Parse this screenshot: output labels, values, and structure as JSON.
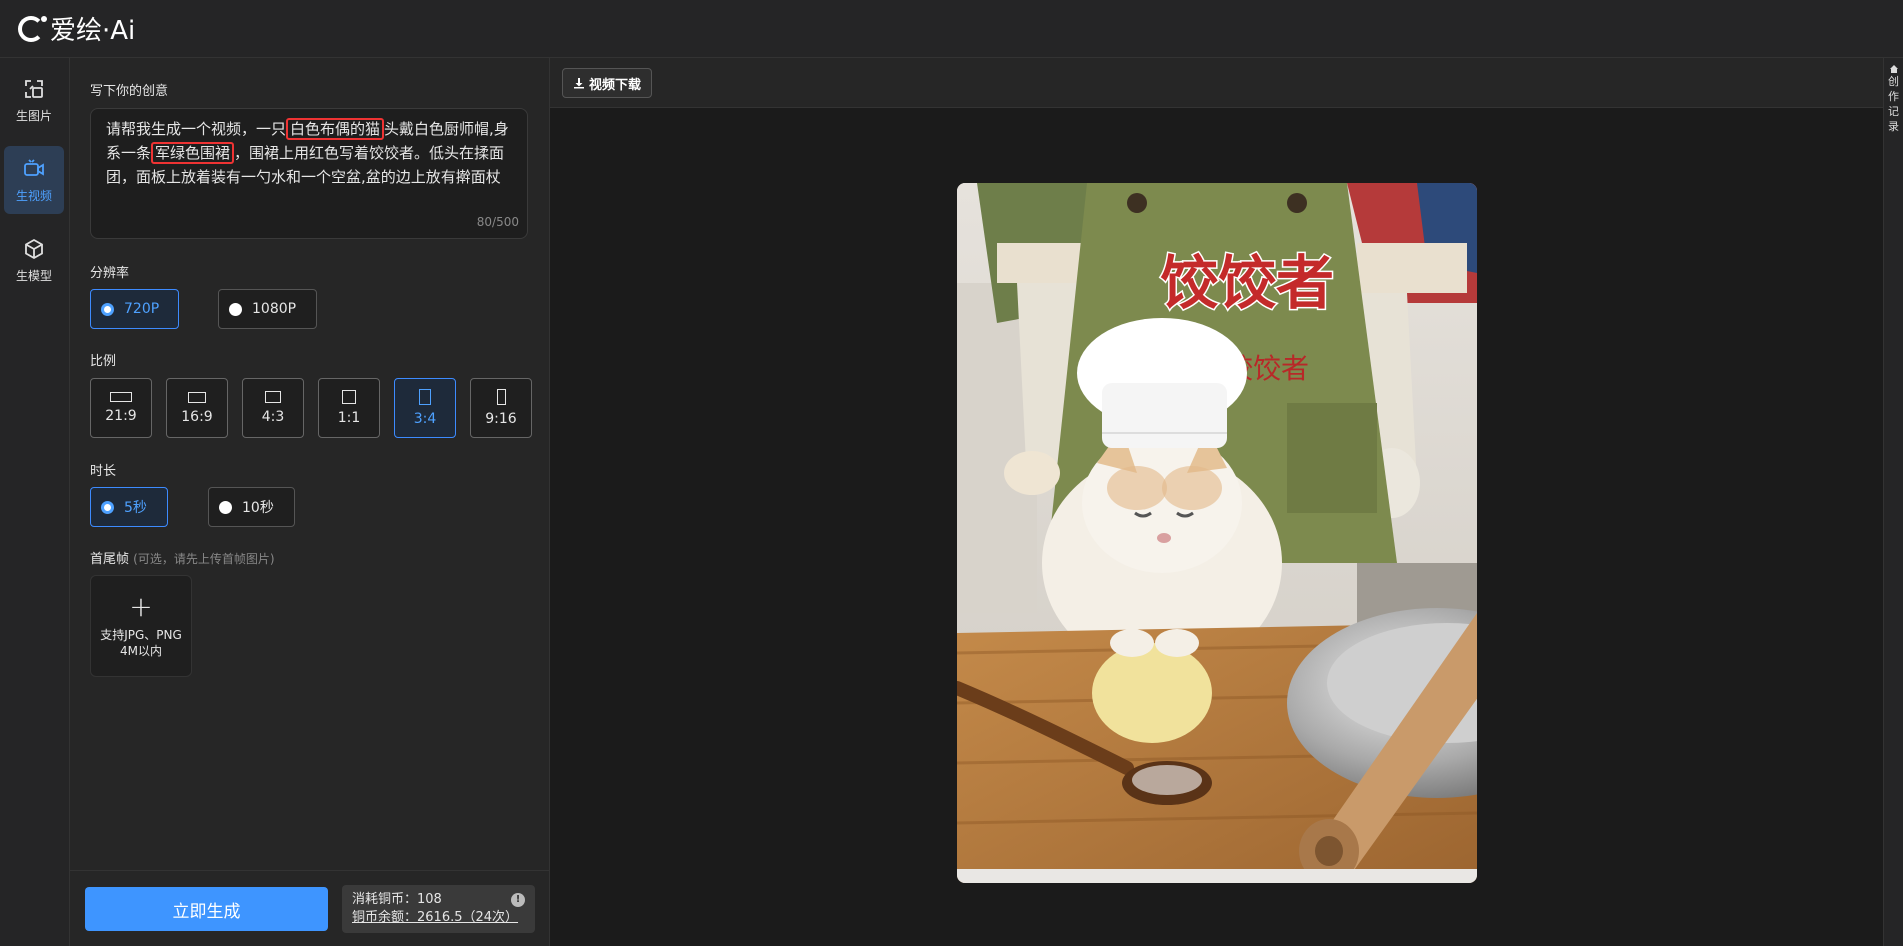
{
  "brand": {
    "name": "爱绘·Ai"
  },
  "nav": [
    {
      "label": "生图片",
      "icon": "image-generate-icon"
    },
    {
      "label": "生视频",
      "icon": "video-generate-icon"
    },
    {
      "label": "生模型",
      "icon": "cube-model-icon"
    }
  ],
  "prompt": {
    "label": "写下你的创意",
    "text_1": "请帮我生成一个视频，一只",
    "hl_1": "白色布偶的猫",
    "text_2": "头戴白色厨师帽,身系一条",
    "hl_2": "军绿色围裙",
    "text_3": "，围裙上用红色写着饺饺者。低头在揉面团，面板上放着装有一勺水和一个空盆,盆的边上放有擀面杖",
    "counter": "80/500"
  },
  "resolution": {
    "label": "分辨率",
    "options": [
      "720P",
      "1080P"
    ],
    "selected": "720P"
  },
  "ratio": {
    "label": "比例",
    "options": [
      "21:9",
      "16:9",
      "4:3",
      "1:1",
      "3:4",
      "9:16"
    ],
    "selected": "3:4"
  },
  "duration": {
    "label": "时长",
    "options": [
      "5秒",
      "10秒"
    ],
    "selected": "5秒"
  },
  "frames": {
    "label": "首尾帧",
    "hint": "(可选，请先上传首帧图片)",
    "upload_line1": "支持JPG、PNG",
    "upload_line2": "4M以内"
  },
  "generate": {
    "button": "立即生成"
  },
  "cost": {
    "consume": "消耗铜币：108",
    "balance": "铜币余额：2616.5（24次）"
  },
  "toolbar": {
    "download": "视频下载"
  },
  "right_panel": {
    "label_chars": [
      "创",
      "作",
      "记",
      "录"
    ]
  },
  "video": {
    "apron_title": "饺饺者",
    "apron_sub": "饺饺者"
  },
  "colors": {
    "accent": "#3e95ff",
    "highlight": "#e33333",
    "apron": "#7d8a4e"
  }
}
